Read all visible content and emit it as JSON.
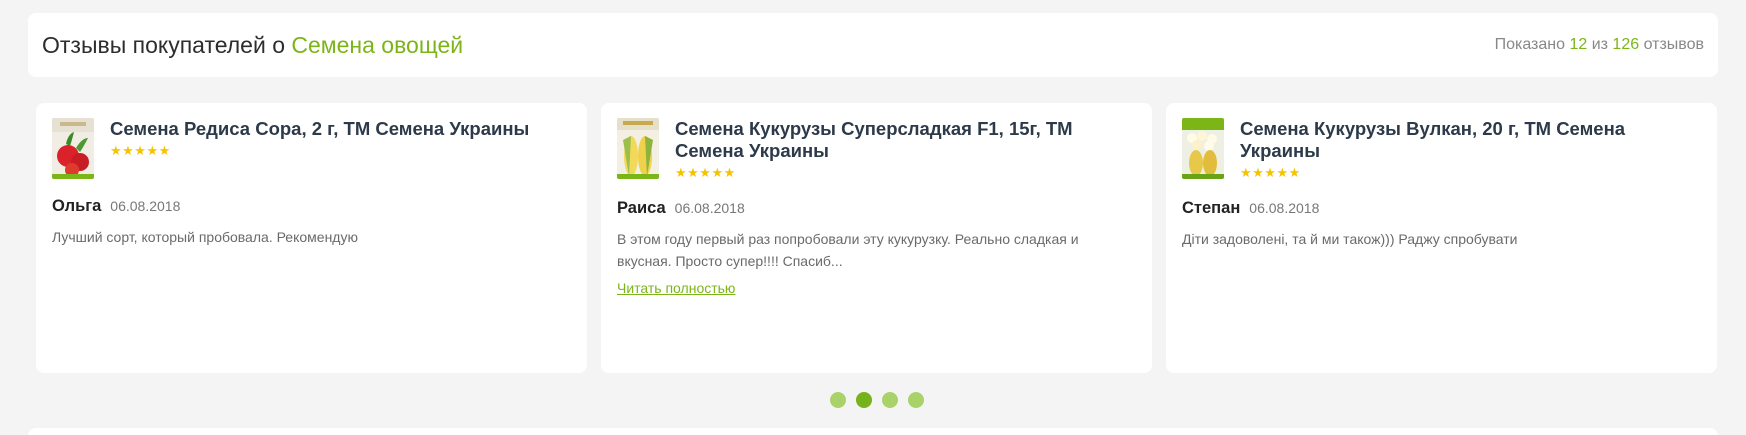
{
  "header": {
    "title_prefix": "Отзывы покупателей о ",
    "title_link": "Семена овощей",
    "count_prefix": "Показано ",
    "count_shown": "12",
    "count_mid": " из ",
    "count_total": "126",
    "count_suffix": " отзывов"
  },
  "colors": {
    "accent": "#7cb518",
    "star": "#f5c400",
    "dot": "#a9d36a",
    "dot_active": "#76b21c"
  },
  "reviews": [
    {
      "product": "Семена Редиса Сора, 2 г, ТМ Семена Украины",
      "stars": "★★★★★",
      "author": "Ольга",
      "date": "06.08.2018",
      "text": "Лучший сорт, который пробовала. Рекомендую",
      "thumb_icon": "radish-seed-pack-icon"
    },
    {
      "product": "Семена Кукурузы Суперсладкая F1, 15г, ТМ Семена Украины",
      "stars": "★★★★★",
      "author": "Раиса",
      "date": "06.08.2018",
      "text": "В этом году первый раз попробовали эту кукурузку. Реально сладкая и вкусная. Просто супер!!!! Спасиб...",
      "read_more": "Читать полностью",
      "thumb_icon": "corn-seed-pack-icon"
    },
    {
      "product": "Семена Кукурузы Вулкан, 20 г, ТМ Семена Украины",
      "stars": "★★★★★",
      "author": "Степан",
      "date": "06.08.2018",
      "text": "Діти задоволені, та й ми також))) Раджу спробувати",
      "thumb_icon": "popcorn-seed-pack-icon"
    }
  ],
  "pagination": {
    "count": 4,
    "active_index": 1
  }
}
